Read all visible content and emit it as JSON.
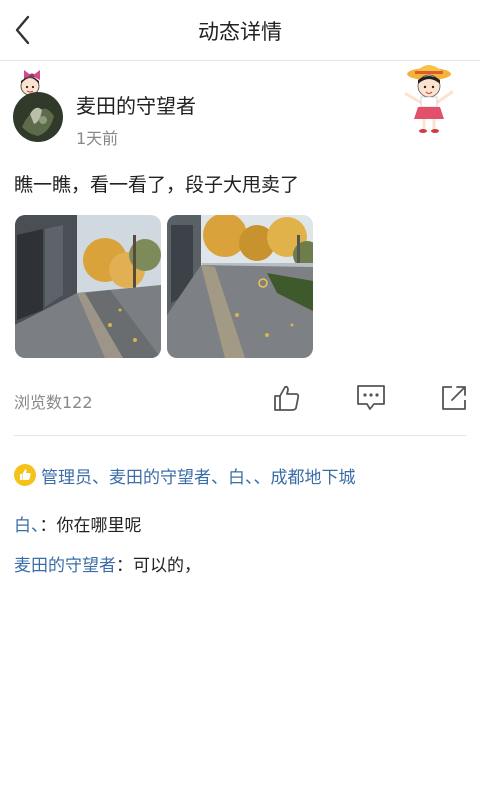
{
  "header": {
    "title": "动态详情",
    "back_icon": "chevron-left-icon"
  },
  "post": {
    "author": "麦田的守望者",
    "time": "1天前",
    "content": "瞧一瞧，看一看了，段子大甩卖了",
    "images": [
      "street-autumn-photo-1",
      "street-autumn-photo-2"
    ],
    "views_label": "浏览数122"
  },
  "actions": {
    "like_icon": "thumbs-up-icon",
    "comment_icon": "comment-icon",
    "share_icon": "share-icon"
  },
  "likes": {
    "text": "管理员、麦田的守望者、白、、成都地下城",
    "icon": "thumbs-up-badge-icon"
  },
  "comments": [
    {
      "author": "白、",
      "sep": "：",
      "text": "你在哪里呢"
    },
    {
      "author": "麦田的守望者",
      "sep": "：",
      "text": "可以的，"
    }
  ],
  "colors": {
    "link": "#3b6da8",
    "muted": "#888888",
    "like_badge": "#f5c21b"
  }
}
